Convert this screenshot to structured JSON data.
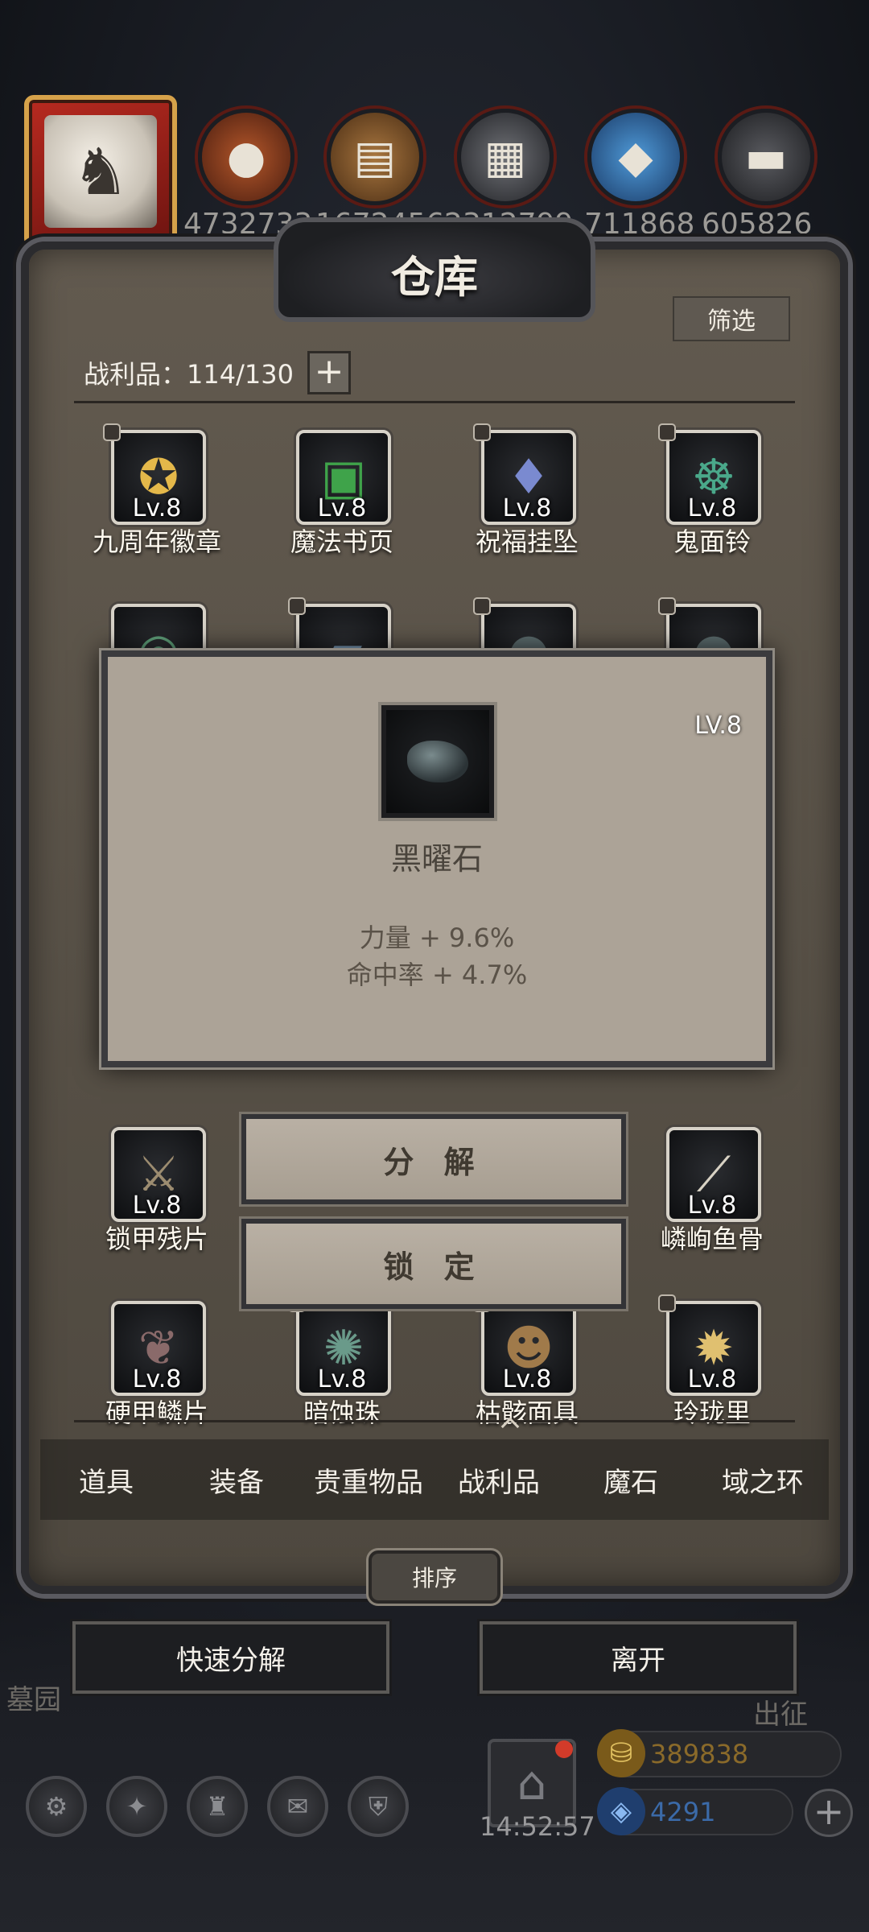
{
  "hud": {
    "resources": [
      {
        "icon": "meat-icon",
        "value": "4732733",
        "color": "#a14a20"
      },
      {
        "icon": "wood-icon",
        "value": "1672456",
        "color": "#8b5a2b"
      },
      {
        "icon": "stone-icon",
        "value": "2312799",
        "color": "#5a5c60"
      },
      {
        "icon": "crystal-icon",
        "value": "711868",
        "color": "#3a7ec0"
      },
      {
        "icon": "iron-icon",
        "value": "605826",
        "color": "#4e4f54"
      }
    ]
  },
  "panel": {
    "title": "仓库",
    "filter_label": "筛选",
    "capacity_label": "战利品：114/130",
    "plus_label": "+"
  },
  "items": {
    "row1": [
      {
        "name": "九周年徽章",
        "lv": "Lv.8",
        "icon": "badge-icon",
        "locked": true
      },
      {
        "name": "魔法书页",
        "lv": "Lv.8",
        "icon": "spellbook-page-icon",
        "locked": false
      },
      {
        "name": "祝福挂坠",
        "lv": "Lv.8",
        "icon": "pendant-icon",
        "locked": true
      },
      {
        "name": "鬼面铃",
        "lv": "Lv.8",
        "icon": "ghost-bell-icon",
        "locked": true
      }
    ],
    "row3": [
      {
        "name": "锁甲残片",
        "lv": "Lv.8",
        "icon": "chainmail-fragment-icon",
        "locked": false
      },
      {
        "name": "嶙峋鱼骨",
        "lv": "Lv.8",
        "icon": "fishbone-icon",
        "locked": false
      }
    ],
    "row4": [
      {
        "name": "硬甲鳞片",
        "lv": "Lv.8",
        "icon": "scale-icon",
        "locked": false
      },
      {
        "name": "暗蚀珠",
        "lv": "Lv.8",
        "icon": "dark-orb-icon",
        "locked": true
      },
      {
        "name": "枯骸面具",
        "lv": "Lv.8",
        "icon": "mask-icon",
        "locked": true
      },
      {
        "name": "玲珑里",
        "lv": "Lv.8",
        "icon": "lantern-icon",
        "locked": true
      }
    ]
  },
  "tooltip": {
    "lv": "LV.8",
    "name": "黑曜石",
    "stats": [
      "力量 + 9.6%",
      "命中率 + 4.7%"
    ]
  },
  "actions": {
    "decompose": "分 解",
    "lock": "锁 定"
  },
  "tabs": [
    "道具",
    "装备",
    "贵重物品",
    "战利品",
    "魔石",
    "域之环"
  ],
  "active_tab": "战利品",
  "sort_label": "排序",
  "quick_decompose": "快速分解",
  "leave": "离开",
  "side_labels": {
    "left": "墓园",
    "right": "出征"
  },
  "footer": {
    "timer": "14:52:57",
    "gold": "389838",
    "gems": "4291",
    "gold_color": "#8a6a2a",
    "gem_color": "#3b6aa8"
  }
}
